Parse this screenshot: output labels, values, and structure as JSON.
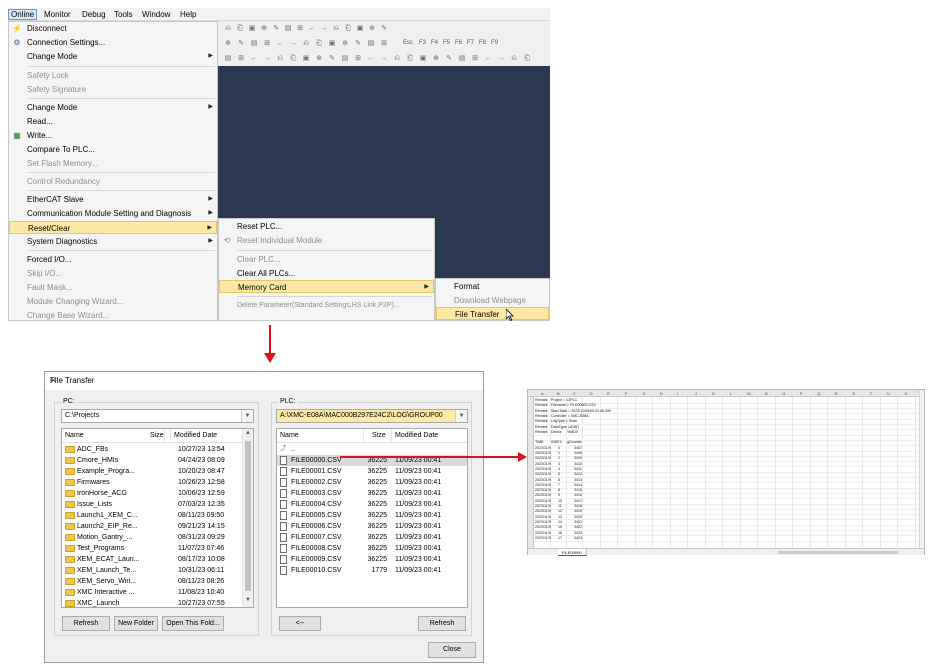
{
  "menubar": [
    "Online",
    "Monitor",
    "Debug",
    "Tools",
    "Window",
    "Help"
  ],
  "online_menu": [
    {
      "label": "Disconnect",
      "disabled": false,
      "icon": "disconnect-icon"
    },
    {
      "label": "Connection Settings...",
      "disabled": false,
      "icon": "connection-settings-icon"
    },
    {
      "label": "Change Mode",
      "disabled": false,
      "submenu": true
    },
    {
      "label": "Safety Lock",
      "disabled": true
    },
    {
      "label": "Safety Signature",
      "disabled": true
    },
    {
      "label": "Change Mode",
      "disabled": false,
      "submenu": true
    },
    {
      "label": "Read...",
      "disabled": false
    },
    {
      "label": "Write...",
      "disabled": false,
      "icon": "write-icon"
    },
    {
      "label": "Compare To PLC...",
      "disabled": false
    },
    {
      "label": "Set Flash Memory...",
      "disabled": true
    },
    {
      "label": "Control Redundancy",
      "disabled": true
    },
    {
      "label": "EtherCAT Slave",
      "disabled": false,
      "submenu": true
    },
    {
      "label": "Communication Module Setting and Diagnosis",
      "disabled": false,
      "submenu": true
    },
    {
      "label": "Reset/Clear",
      "disabled": false,
      "submenu": true,
      "highlighted": true
    },
    {
      "label": "System Diagnostics",
      "disabled": false,
      "submenu": true
    },
    {
      "label": "Forced I/O...",
      "disabled": false
    },
    {
      "label": "Skip I/O...",
      "disabled": true
    },
    {
      "label": "Fault Mask...",
      "disabled": true
    },
    {
      "label": "Module Changing Wizard...",
      "disabled": true
    },
    {
      "label": "Change Base Wizard...",
      "disabled": true
    }
  ],
  "reset_menu": [
    {
      "label": "Reset PLC...",
      "disabled": false
    },
    {
      "label": "Reset Individual Module",
      "disabled": true,
      "icon": "reset-module-icon"
    },
    {
      "label": "Clear PLC...",
      "disabled": true
    },
    {
      "label": "Clear All PLCs...",
      "disabled": false
    },
    {
      "label": "Memory Card",
      "disabled": false,
      "submenu": true,
      "highlighted": true
    },
    {
      "label": "Delete Parameter(Standard Settings,HS Link,P2P)...",
      "disabled": true
    }
  ],
  "memory_card_menu": [
    {
      "label": "Format",
      "disabled": false
    },
    {
      "label": "Download Webpage",
      "disabled": true
    },
    {
      "label": "File Transfer",
      "disabled": false,
      "highlighted": true
    }
  ],
  "toolbar_function_keys": [
    "Esc",
    "F3",
    "F4",
    "F5",
    "F6",
    "F7",
    "F8",
    "F9"
  ],
  "dialog": {
    "title": "File Transfer",
    "pc_label": "PC:",
    "pc_path": "C:\\Projects",
    "plc_label": "PLC:",
    "plc_path": "A:\\XMC-E08A\\MAC000B297E24C2\\LOG\\GROUP00",
    "col_name": "Name",
    "col_size": "Size",
    "col_modified": "Modified Date",
    "pc_files": [
      {
        "name": "ADC_FBs",
        "date": "10/27/23  13:54"
      },
      {
        "name": "Cmore_HMIs",
        "date": "04/24/23  08:09"
      },
      {
        "name": "Example_Progra...",
        "date": "10/20/23  08:47"
      },
      {
        "name": "Firmwares",
        "date": "10/26/23  12:58"
      },
      {
        "name": "IronHorse_ACG",
        "date": "10/06/23  12:59"
      },
      {
        "name": "Issue_Lists",
        "date": "07/03/23  12:35"
      },
      {
        "name": "Launch1_XEM_C...",
        "date": "08/11/23  09:50"
      },
      {
        "name": "Launch2_EIP_Re...",
        "date": "09/21/23  14:15"
      },
      {
        "name": "Motion_Gantry_...",
        "date": "08/31/23  09:29"
      },
      {
        "name": "Test_Programs",
        "date": "11/07/23  07:46"
      },
      {
        "name": "XEM_ECAT_Laun...",
        "date": "08/17/23  10:08"
      },
      {
        "name": "XEM_Launch_Te...",
        "date": "10/31/23  06:11"
      },
      {
        "name": "XEM_Servo_Wiri...",
        "date": "08/11/23  08:26"
      },
      {
        "name": "XMC Interactive ...",
        "date": "11/08/23  10:40"
      },
      {
        "name": "XMC_Launch",
        "date": "10/27/23  07:55"
      }
    ],
    "plc_up": "..",
    "plc_files": [
      {
        "name": "FILE00000.CSV",
        "size": "36225",
        "date": "11/09/23  00:41"
      },
      {
        "name": "FILE00001.CSV",
        "size": "36225",
        "date": "11/09/23  00:41"
      },
      {
        "name": "FILE00002.CSV",
        "size": "36225",
        "date": "11/09/23  00:41"
      },
      {
        "name": "FILE00003.CSV",
        "size": "36225",
        "date": "11/09/23  00:41"
      },
      {
        "name": "FILE00004.CSV",
        "size": "36225",
        "date": "11/09/23  00:41"
      },
      {
        "name": "FILE00005.CSV",
        "size": "36225",
        "date": "11/09/23  00:41"
      },
      {
        "name": "FILE00006.CSV",
        "size": "36225",
        "date": "11/09/23  00:41"
      },
      {
        "name": "FILE00007.CSV",
        "size": "36225",
        "date": "11/09/23  00:41"
      },
      {
        "name": "FILE00008.CSV",
        "size": "36225",
        "date": "11/09/23  00:41"
      },
      {
        "name": "FILE00009.CSV",
        "size": "36225",
        "date": "11/09/23  00:41"
      },
      {
        "name": "FILE00010.CSV",
        "size": "1779",
        "date": "11/09/23  00:41"
      }
    ],
    "btn_refresh": "Refresh",
    "btn_new_folder": "New Folder",
    "btn_open_folder": "Open This Fold...",
    "btn_back": "<--",
    "btn_plc_refresh": "Refresh",
    "btn_close": "Close"
  },
  "spreadsheet": {
    "columns": [
      "A",
      "B",
      "C",
      "D",
      "E",
      "F",
      "G",
      "H",
      "I",
      "J",
      "K",
      "L",
      "M",
      "N",
      "O",
      "P",
      "Q",
      "R",
      "S",
      "T",
      "U",
      "V"
    ],
    "remarks": [
      [
        "Remark",
        "Project = 13PLC"
      ],
      [
        "Remark",
        "Filename = FILE00000.CSV"
      ],
      [
        "Remark",
        "Start Date = 2023/11/09/00:41:46.290"
      ],
      [
        "Remark",
        "Controller = XMC-E08A"
      ],
      [
        "Remark",
        "LogType = Scan"
      ],
      [
        "Remark",
        "DataType: UDINT"
      ],
      [
        "Remark",
        "Device",
        "%MD0"
      ]
    ],
    "header": [
      "TIME",
      "INDEX",
      "gCounter"
    ],
    "rows": [
      [
        "2023/11/9",
        "0",
        "3407"
      ],
      [
        "2023/11/9",
        "1",
        "3408"
      ],
      [
        "2023/11/9",
        "2",
        "3409"
      ],
      [
        "2023/11/9",
        "3",
        "3410"
      ],
      [
        "2023/11/9",
        "4",
        "3411"
      ],
      [
        "2023/11/9",
        "5",
        "3412"
      ],
      [
        "2023/11/9",
        "6",
        "3413"
      ],
      [
        "2023/11/9",
        "7",
        "3414"
      ],
      [
        "2023/11/9",
        "8",
        "3415"
      ],
      [
        "2023/11/9",
        "9",
        "3416"
      ],
      [
        "2023/11/9",
        "10",
        "3417"
      ],
      [
        "2023/11/9",
        "11",
        "3418"
      ],
      [
        "2023/11/9",
        "12",
        "3419"
      ],
      [
        "2023/11/9",
        "13",
        "3420"
      ],
      [
        "2023/11/9",
        "14",
        "3421"
      ],
      [
        "2023/11/9",
        "15",
        "3422"
      ],
      [
        "2023/11/9",
        "16",
        "3423"
      ],
      [
        "2023/11/9",
        "17",
        "3424"
      ]
    ],
    "sheet_tab": "FILE00000"
  }
}
